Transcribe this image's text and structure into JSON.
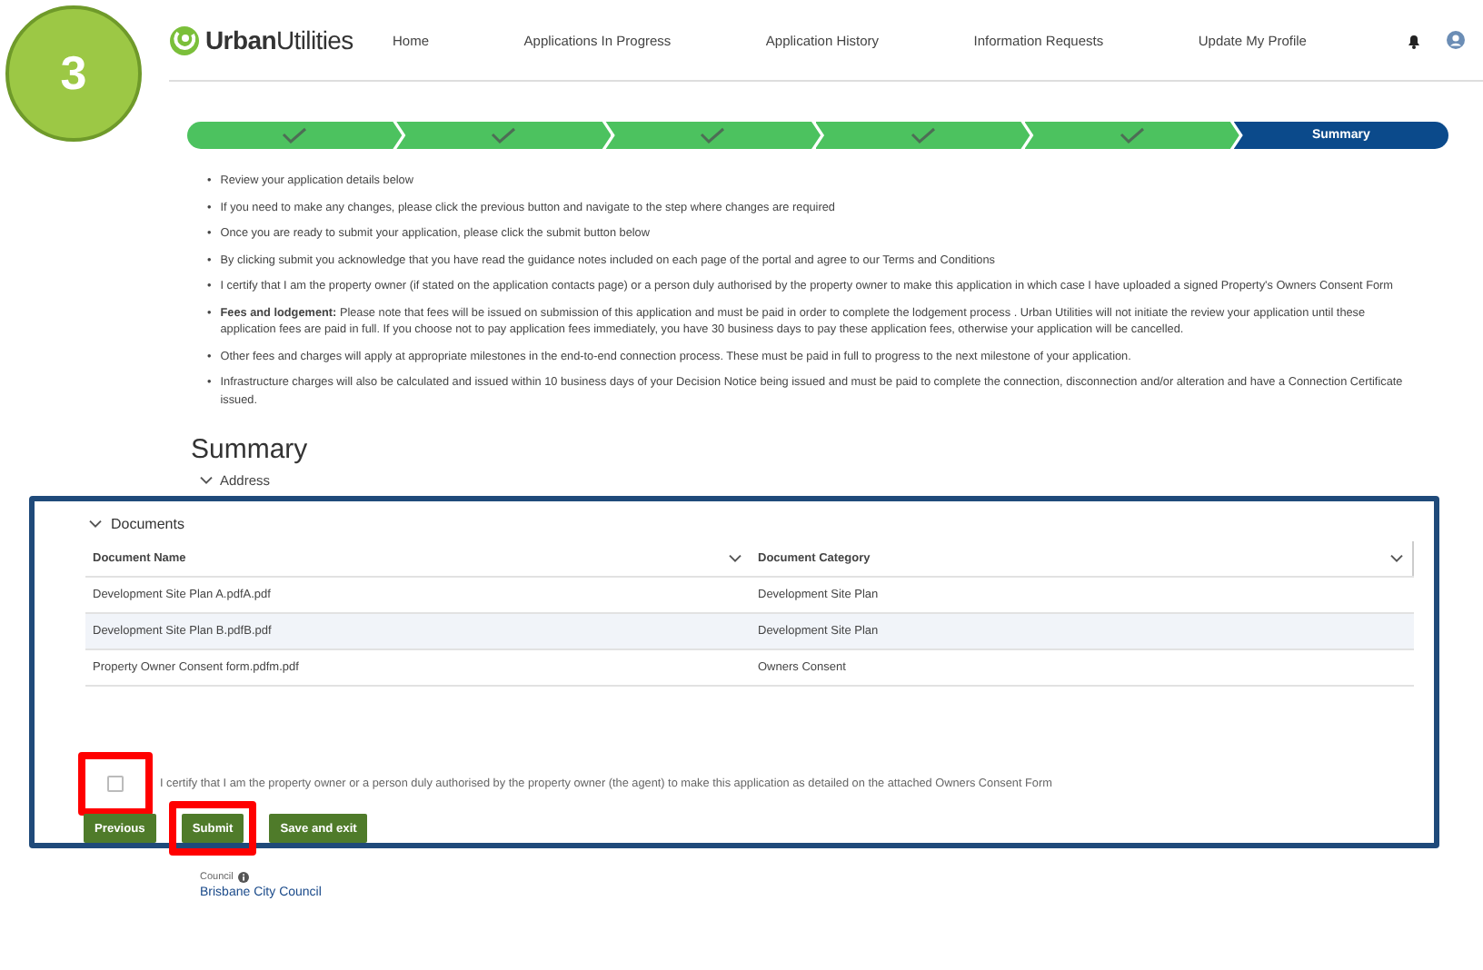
{
  "step_badge": "3",
  "header": {
    "brand_bold": "Urban",
    "brand_light": "Utilities",
    "nav": [
      "Home",
      "Applications In Progress",
      "Application History",
      "Information Requests",
      "Update My Profile"
    ]
  },
  "stepper": [
    {
      "done": true,
      "selected": false
    },
    {
      "done": true,
      "selected": false
    },
    {
      "done": true,
      "selected": false
    },
    {
      "done": true,
      "selected": false
    },
    {
      "done": true,
      "selected": false
    },
    {
      "done": false,
      "selected": true,
      "label": "Summary"
    }
  ],
  "bullet": "•",
  "instructions": [
    "Review your application details below",
    "If you need to make any changes, please click the previous button and navigate to the step where changes are required",
    "Once you are ready to submit your application, please click the submit button below",
    "By clicking submit you acknowledge that you have read the guidance notes included on each page of the portal and agree to our Terms and Conditions",
    "I certify that I am the property owner (if stated on the application contacts page) or a person duly authorised by the property owner to make this application in which case I have uploaded a signed Property's Owners Consent Form",
    "**Fees and lodgement:** Please note that fees will be issued on submission of this application and must be paid in order to complete the lodgement process . Urban Utilities will not initiate the review your application until these application fees are paid in full. If you choose not to pay application fees immediately, you have 30 business days to pay these application fees, otherwise your application will be cancelled.",
    "Other fees and charges will apply at appropriate milestones in the end-to-end connection process. These must be paid in full to progress to the next milestone of your application.",
    "Infrastructure charges will also be calculated and issued within 10 business days of your Decision Notice being issued and must be paid to complete the connection, disconnection and/or alteration and have a Connection Certificate issued."
  ],
  "summary": {
    "title": "Summary",
    "sections": [
      {
        "label": "Address",
        "expanded": true
      }
    ]
  },
  "documents": {
    "title": "Documents",
    "expanded": true,
    "columns": [
      "Document Name",
      "Document Category"
    ],
    "rows": [
      {
        "name": "Development Site Plan A.pdfA.pdf",
        "category": "Development Site Plan",
        "selected": false
      },
      {
        "name": "Development Site Plan B.pdfB.pdf",
        "category": "Development Site Plan",
        "selected": true
      },
      {
        "name": "Property Owner Consent form.pdfm.pdf",
        "category": "Owners Consent",
        "selected": false
      }
    ]
  },
  "certify": {
    "text": "I certify that I am the property owner or a person duly authorised by the property owner (the agent) to make this application as detailed on the attached Owners Consent Form",
    "checked": false,
    "highlighted": true
  },
  "buttons": [
    {
      "label": "Previous",
      "highlighted": false
    },
    {
      "label": "Submit",
      "highlighted": true
    },
    {
      "label": "Save and exit",
      "highlighted": false
    }
  ],
  "council": {
    "label": "Council",
    "value": "Brisbane City Council"
  }
}
